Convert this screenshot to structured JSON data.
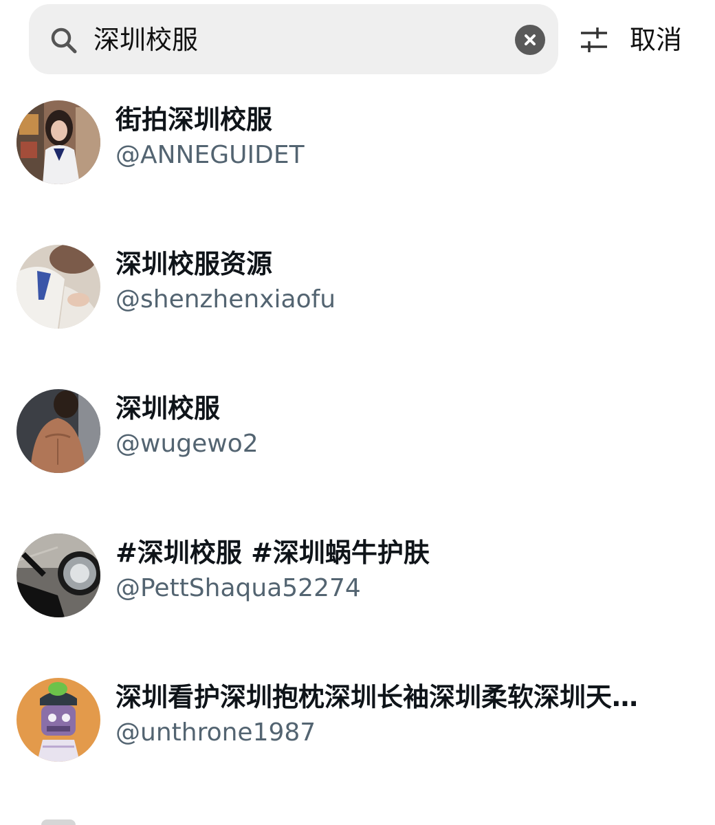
{
  "search": {
    "query": "深圳校服",
    "cancel_label": "取消"
  },
  "icons": {
    "search": "search-icon",
    "clear": "clear-icon",
    "filter": "filter-icon"
  },
  "results": [
    {
      "name": "街拍深圳校服",
      "handle": "@ANNEGUIDET"
    },
    {
      "name": "深圳校服资源",
      "handle": "@shenzhenxiaofu"
    },
    {
      "name": "深圳校服",
      "handle": "@wugewo2"
    },
    {
      "name": "#深圳校服 #深圳蜗牛护肤",
      "handle": "@PettShaqua52274"
    },
    {
      "name": "深圳看护深圳抱枕深圳长袖深圳柔软深圳天…",
      "handle": "@unthrone1987"
    }
  ],
  "colors": {
    "text_primary": "#0f1419",
    "text_secondary": "#536471",
    "search_bg": "#efefef"
  }
}
